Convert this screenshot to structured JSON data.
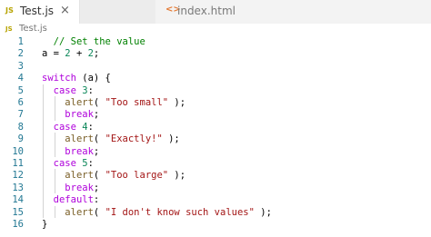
{
  "tabs": [
    {
      "icon": "JS",
      "label": "Test.js",
      "active": true,
      "close": "×"
    },
    {
      "icon": "<>",
      "label": "index.html",
      "active": false
    }
  ],
  "breadcrumb": {
    "icon": "JS",
    "label": "Test.js"
  },
  "colors": {
    "comment": "#008000",
    "keyword": "#af00db",
    "number": "#098658",
    "string": "#a31515",
    "function": "#795e26",
    "line_number": "#237893"
  },
  "lines": [
    {
      "n": "1",
      "tokens": [
        {
          "t": "  ",
          "c": "pl"
        },
        {
          "t": "// Set the value",
          "c": "com"
        }
      ]
    },
    {
      "n": "2",
      "tokens": [
        {
          "t": "a",
          "c": "pl"
        },
        {
          "t": " = ",
          "c": "pl"
        },
        {
          "t": "2",
          "c": "num"
        },
        {
          "t": " + ",
          "c": "pl"
        },
        {
          "t": "2",
          "c": "num"
        },
        {
          "t": ";",
          "c": "pl"
        }
      ]
    },
    {
      "n": "3",
      "tokens": []
    },
    {
      "n": "4",
      "tokens": [
        {
          "t": "switch",
          "c": "kw"
        },
        {
          "t": " (a) {",
          "c": "pl"
        }
      ]
    },
    {
      "n": "5",
      "tokens": [
        {
          "t": "  ",
          "c": "pl"
        },
        {
          "t": "case",
          "c": "kw"
        },
        {
          "t": " ",
          "c": "pl"
        },
        {
          "t": "3",
          "c": "num"
        },
        {
          "t": ":",
          "c": "pl"
        }
      ]
    },
    {
      "n": "6",
      "tokens": [
        {
          "t": "    ",
          "c": "pl"
        },
        {
          "t": "alert",
          "c": "fn"
        },
        {
          "t": "( ",
          "c": "pl"
        },
        {
          "t": "\"Too small\"",
          "c": "str"
        },
        {
          "t": " );",
          "c": "pl"
        }
      ]
    },
    {
      "n": "7",
      "tokens": [
        {
          "t": "    ",
          "c": "pl"
        },
        {
          "t": "break",
          "c": "kw"
        },
        {
          "t": ";",
          "c": "pl"
        }
      ]
    },
    {
      "n": "8",
      "tokens": [
        {
          "t": "  ",
          "c": "pl"
        },
        {
          "t": "case",
          "c": "kw"
        },
        {
          "t": " ",
          "c": "pl"
        },
        {
          "t": "4",
          "c": "num"
        },
        {
          "t": ":",
          "c": "pl"
        }
      ]
    },
    {
      "n": "9",
      "tokens": [
        {
          "t": "    ",
          "c": "pl"
        },
        {
          "t": "alert",
          "c": "fn"
        },
        {
          "t": "( ",
          "c": "pl"
        },
        {
          "t": "\"Exactly!\"",
          "c": "str"
        },
        {
          "t": " );",
          "c": "pl"
        }
      ]
    },
    {
      "n": "10",
      "tokens": [
        {
          "t": "    ",
          "c": "pl"
        },
        {
          "t": "break",
          "c": "kw"
        },
        {
          "t": ";",
          "c": "pl"
        }
      ]
    },
    {
      "n": "11",
      "tokens": [
        {
          "t": "  ",
          "c": "pl"
        },
        {
          "t": "case",
          "c": "kw"
        },
        {
          "t": " ",
          "c": "pl"
        },
        {
          "t": "5",
          "c": "num"
        },
        {
          "t": ":",
          "c": "pl"
        }
      ]
    },
    {
      "n": "12",
      "tokens": [
        {
          "t": "    ",
          "c": "pl"
        },
        {
          "t": "alert",
          "c": "fn"
        },
        {
          "t": "( ",
          "c": "pl"
        },
        {
          "t": "\"Too large\"",
          "c": "str"
        },
        {
          "t": " );",
          "c": "pl"
        }
      ]
    },
    {
      "n": "13",
      "tokens": [
        {
          "t": "    ",
          "c": "pl"
        },
        {
          "t": "break",
          "c": "kw"
        },
        {
          "t": ";",
          "c": "pl"
        }
      ]
    },
    {
      "n": "14",
      "tokens": [
        {
          "t": "  ",
          "c": "pl"
        },
        {
          "t": "default",
          "c": "kw"
        },
        {
          "t": ":",
          "c": "pl"
        }
      ]
    },
    {
      "n": "15",
      "tokens": [
        {
          "t": "    ",
          "c": "pl"
        },
        {
          "t": "alert",
          "c": "fn"
        },
        {
          "t": "( ",
          "c": "pl"
        },
        {
          "t": "\"I don't know such values\"",
          "c": "str"
        },
        {
          "t": " );",
          "c": "pl"
        }
      ]
    },
    {
      "n": "16",
      "tokens": [
        {
          "t": "}",
          "c": "pl"
        }
      ]
    }
  ]
}
